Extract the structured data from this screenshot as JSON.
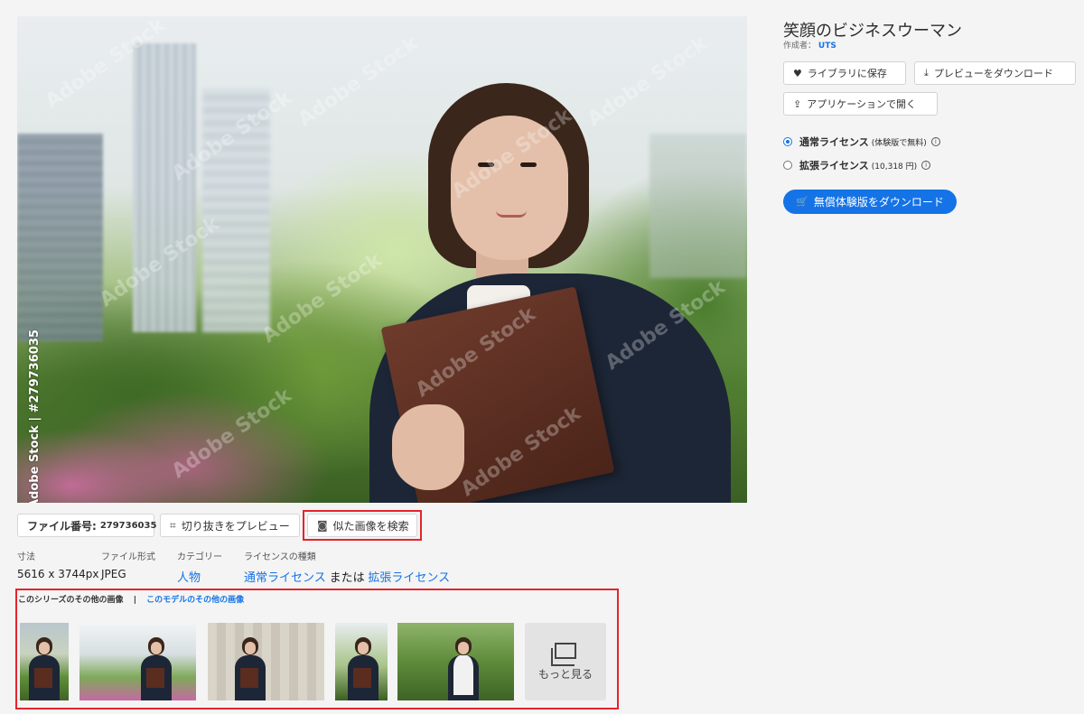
{
  "preview": {
    "watermark": "Adobe Stock",
    "side_credit": "Adobe Stock | #279736035"
  },
  "toolbar": {
    "file_number_label": "ファイル番号:",
    "file_number": "279736035",
    "crop_preview_label": "切り抜きをプレビュー",
    "similar_search_label": "似た画像を検索"
  },
  "meta": {
    "dimensions_label": "寸法",
    "dimensions_value": "5616 x 3744px",
    "format_label": "ファイル形式",
    "format_value": "JPEG",
    "category_label": "カテゴリー",
    "category_value": "人物",
    "license_type_label": "ライセンスの種類",
    "license_standard": "通常ライセンス",
    "license_or": "または",
    "license_extended": "拡張ライセンス"
  },
  "series": {
    "tab_series": "このシリーズのその他の画像",
    "separator": "|",
    "tab_model": "このモデルのその他の画像",
    "more_label": "もっと見る",
    "thumbnail_count": 5
  },
  "panel": {
    "title": "笑顔のビジネスウーマン",
    "author_prefix": "作成者：",
    "author_name": "UTS",
    "save_library": "ライブラリに保存",
    "download_preview": "プレビューをダウンロード",
    "open_in_app": "アプリケーションで開く",
    "license_standard_name": "通常ライセンス",
    "license_standard_note": "(体験版で無料)",
    "license_extended_name": "拡張ライセンス",
    "license_extended_note": "(10,318 円)",
    "info_glyph": "i",
    "download_trial": "無償体験版をダウンロード"
  },
  "colors": {
    "accent": "#1473e6",
    "highlight": "#e4242d"
  }
}
